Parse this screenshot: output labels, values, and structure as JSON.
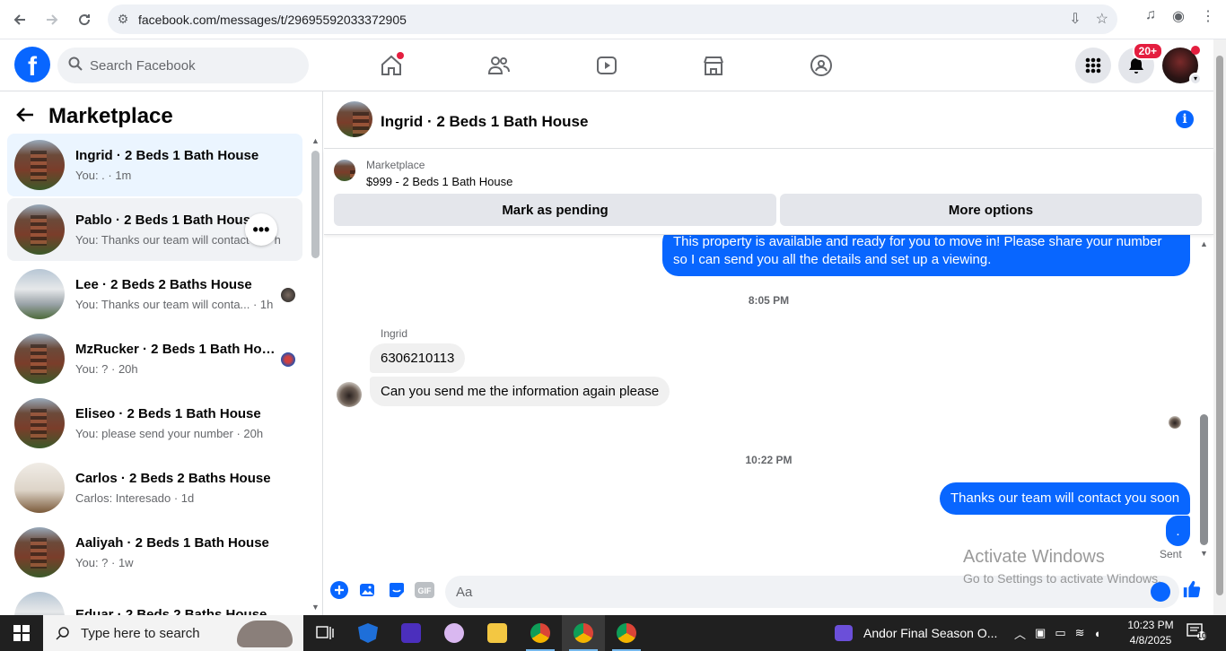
{
  "browser": {
    "url": "facebook.com/messages/t/29695592033372905"
  },
  "fb": {
    "search_placeholder": "Search Facebook",
    "notification_badge": "20+"
  },
  "sidebar": {
    "title": "Marketplace",
    "conversations": [
      {
        "title": "Ingrid · 2 Beds 1 Bath House",
        "subtitle": "You: . · 1m",
        "thumb": "brick"
      },
      {
        "title": "Pablo · 2 Beds 1 Bath House",
        "subtitle": "You: Thanks our team will contact",
        "suffix": "h",
        "thumb": "brick"
      },
      {
        "title": "Lee · 2 Beds 2 Baths House",
        "subtitle": "You: Thanks our team will conta... · 1h",
        "thumb": "white"
      },
      {
        "title": "MzRucker · 2 Beds 1 Bath House",
        "subtitle": "You: ? · 20h",
        "thumb": "brick"
      },
      {
        "title": "Eliseo · 2 Beds 1 Bath House",
        "subtitle": "You: please send your number · 20h",
        "thumb": "brick"
      },
      {
        "title": "Carlos · 2 Beds 2 Baths House",
        "subtitle": "Carlos: Interesado · 1d",
        "thumb": "room"
      },
      {
        "title": "Aaliyah · 2 Beds 1 Bath House",
        "subtitle": "You: ? · 1w",
        "thumb": "brick"
      },
      {
        "title": "Eduar · 2 Beds 2 Baths House",
        "subtitle": "",
        "thumb": "white"
      }
    ]
  },
  "chat": {
    "header_title": "Ingrid · 2 Beds 1 Bath House",
    "listing_kind": "Marketplace",
    "listing_price": "$999 - 2 Beds 1 Bath House",
    "mark_pending": "Mark as pending",
    "more_options": "More options",
    "msg_out_1": "This property is available and ready for you to move in! Please share your number so I can send you all the details and set up a viewing.",
    "time_1": "8:05 PM",
    "sender": "Ingrid",
    "msg_in_1": "6306210113",
    "msg_in_2": "Can you send me the information again please",
    "time_2": "10:22 PM",
    "msg_out_2": "Thanks our team will contact you soon",
    "msg_out_3": ".",
    "sent_label": "Sent",
    "composer_placeholder": "Aa"
  },
  "watermark": {
    "line1": "Activate Windows",
    "line2": "Go to Settings to activate Windows."
  },
  "taskbar": {
    "search_text": "Type here to search",
    "media_title": "Andor Final Season O...",
    "time": "10:23 PM",
    "date": "4/8/2025",
    "notif_count": "10"
  },
  "colors": {
    "fb_blue": "#0866ff",
    "active_row": "#ebf5ff"
  }
}
